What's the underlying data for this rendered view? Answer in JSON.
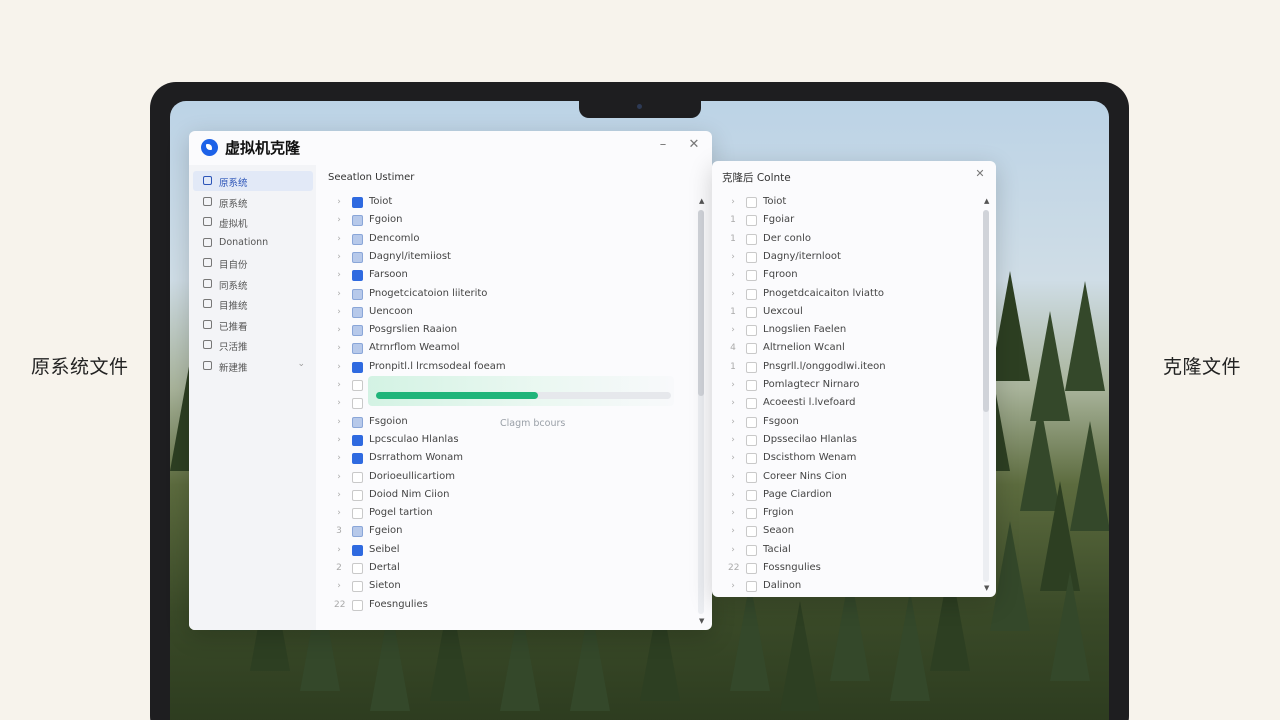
{
  "captions": {
    "left": "原系统文件",
    "right": "克隆文件"
  },
  "main_window": {
    "title": "虚拟机克隆",
    "minimize": "–",
    "close": "✕",
    "panel_title": "Seeatlon Ustimer",
    "sidebar": [
      {
        "label": "原系统",
        "active": true
      },
      {
        "label": "原系统"
      },
      {
        "label": "虚拟机"
      },
      {
        "label": "Donationn"
      },
      {
        "label": "目自份"
      },
      {
        "label": "同系统"
      },
      {
        "label": "目推统"
      },
      {
        "label": "已推看"
      },
      {
        "label": "只活推"
      },
      {
        "label": "新建推",
        "chevron": "⌄"
      }
    ],
    "rows": [
      {
        "exp": "›",
        "check": "on",
        "name": "Toiot"
      },
      {
        "exp": "›",
        "check": "half",
        "name": "Fgoion"
      },
      {
        "exp": "›",
        "check": "half",
        "name": "Dencomlo"
      },
      {
        "exp": "›",
        "check": "half",
        "name": "Dagnyl/itemiiost"
      },
      {
        "exp": "›",
        "check": "on",
        "name": "Farsoon"
      },
      {
        "exp": "›",
        "check": "half",
        "name": "Pnogetcicatoion liiterito"
      },
      {
        "exp": "›",
        "check": "half",
        "name": "Uencoon"
      },
      {
        "exp": "›",
        "check": "half",
        "name": "Posgrslien Raaion"
      },
      {
        "exp": "›",
        "check": "half",
        "name": "Atrnrflom Weamol"
      },
      {
        "exp": "›",
        "check": "on",
        "name": "Pronpitl.l lrcmsodeal foeam"
      },
      {
        "exp": "›",
        "check": "gray",
        "name": ""
      },
      {
        "exp": "›",
        "check": "gray",
        "name": ""
      },
      {
        "exp": "›",
        "check": "half",
        "name": "Fsgoion"
      },
      {
        "exp": "›",
        "check": "on",
        "name": "Lpcsculao Hlanlas"
      },
      {
        "exp": "›",
        "check": "on",
        "name": "Dsrrathom Wonam"
      },
      {
        "exp": "›",
        "check": "gray",
        "name": "Dorioeullicartiom"
      },
      {
        "exp": "›",
        "check": "gray",
        "name": "Doiod Nim Ciion"
      },
      {
        "exp": "›",
        "check": "gray",
        "name": "Pogel tartion"
      },
      {
        "exp": "3",
        "check": "half",
        "name": "Fgeion"
      },
      {
        "exp": "›",
        "check": "on",
        "name": "Seibel"
      },
      {
        "exp": "2",
        "check": "gray",
        "name": "Dertal"
      },
      {
        "exp": "›",
        "check": "gray",
        "name": "Sieton"
      },
      {
        "exp": "22",
        "check": "gray",
        "name": "Foesngulies"
      }
    ],
    "progress": {
      "value": 0.55,
      "label": "Clagm bcours"
    },
    "scroll_up": "▲",
    "scroll_down": "▼"
  },
  "clone_window": {
    "title": "克隆后 Colnte",
    "close": "✕",
    "rows": [
      {
        "exp": "›",
        "name": "Toiot"
      },
      {
        "exp": "1",
        "name": "Fgoiar"
      },
      {
        "exp": "1",
        "name": "Der conlo"
      },
      {
        "exp": "›",
        "name": "Dagny/iternloot"
      },
      {
        "exp": "›",
        "name": "Fqroon"
      },
      {
        "exp": "›",
        "name": "Pnogetdcaicaiton lviatto"
      },
      {
        "exp": "1",
        "name": "Uexcoul"
      },
      {
        "exp": "›",
        "name": "Lnogslien Faelen"
      },
      {
        "exp": "4",
        "name": "Altrnelion Wcanl"
      },
      {
        "exp": "1",
        "name": "Pnsgrll.l/onggodlwi.iteon"
      },
      {
        "exp": "›",
        "name": "Pomlagtecr Nirnaro"
      },
      {
        "exp": "›",
        "name": "Acoeesti l.lvefoard"
      },
      {
        "exp": "›",
        "name": "Fsgoon"
      },
      {
        "exp": "›",
        "name": "Dpssecilao Hlanlas"
      },
      {
        "exp": "›",
        "name": "Dscisthom Wenam"
      },
      {
        "exp": "›",
        "name": "Coreer Nins Cion"
      },
      {
        "exp": "›",
        "name": "Page Ciardion"
      },
      {
        "exp": "›",
        "name": "Frgion"
      },
      {
        "exp": "›",
        "name": "Seaon"
      },
      {
        "exp": "›",
        "name": "Tacial"
      },
      {
        "exp": "22",
        "name": "Fossngulies"
      },
      {
        "exp": "›",
        "name": "Dalinon"
      }
    ],
    "scroll_up": "▲",
    "scroll_down": "▼"
  }
}
